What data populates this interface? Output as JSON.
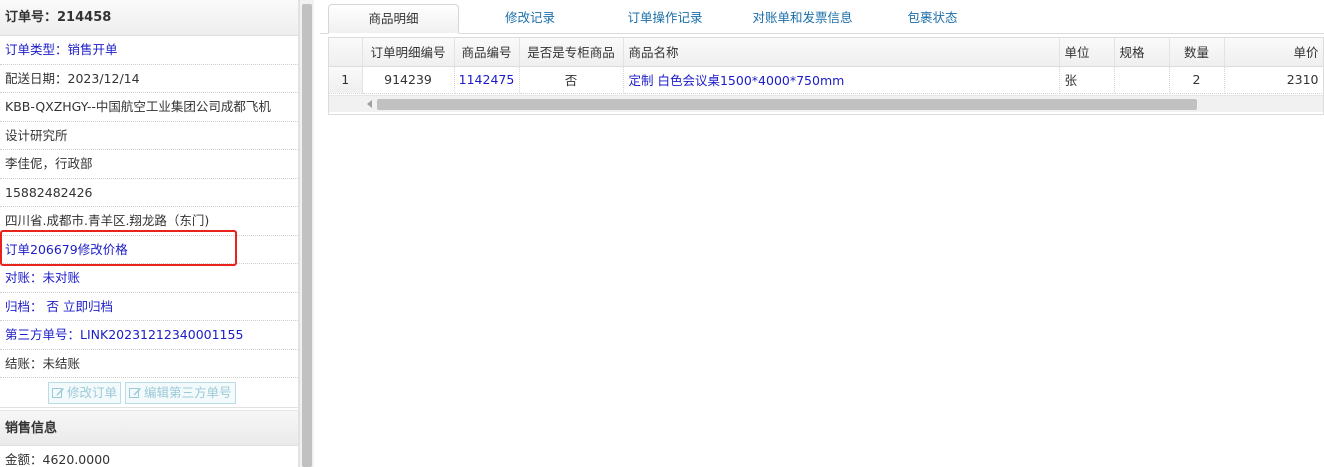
{
  "order": {
    "number_label": "订单号：",
    "number": "214458",
    "rows": [
      {
        "label": "订单类型：",
        "value": "销售开单",
        "style": "blue"
      },
      {
        "label": "配送日期：",
        "value": "2023/12/14",
        "style": "normal"
      },
      {
        "label": "",
        "value": "KBB-QXZHGY--中国航空工业集团公司成都飞机",
        "style": "normal"
      },
      {
        "label": "",
        "value": "设计研究所",
        "style": "normal"
      },
      {
        "label": "",
        "value": "李佳伲，行政部",
        "style": "normal"
      },
      {
        "label": "",
        "value": "15882482426",
        "style": "normal"
      },
      {
        "label": "",
        "value": "四川省.成都市.青羊区.翔龙路（东门)",
        "style": "normal"
      },
      {
        "label": "",
        "value": "订单206679修改价格",
        "style": "blue"
      },
      {
        "label": "对账：",
        "value": "未对账",
        "style": "blue"
      },
      {
        "label": "归档：",
        "value": "否",
        "link": "立即归档",
        "style": "blue"
      },
      {
        "label": "第三方单号：",
        "value": "LINK20231212340001155",
        "style": "blue"
      },
      {
        "label": "结账：",
        "value": "未结账",
        "style": "normal"
      }
    ],
    "buttons": {
      "edit_order": "修改订单",
      "edit_third_party": "编辑第三方单号"
    }
  },
  "sales": {
    "header": "销售信息",
    "amount_label": "金额：",
    "amount": "4620.0000"
  },
  "tabs": [
    {
      "label": "商品明细",
      "active": true
    },
    {
      "label": "修改记录",
      "active": false
    },
    {
      "label": "订单操作记录",
      "active": false
    },
    {
      "label": "对账单和发票信息",
      "active": false
    },
    {
      "label": "包裹状态",
      "active": false
    }
  ],
  "table": {
    "columns": [
      "订单明细编号",
      "商品编号",
      "是否是专柜商品",
      "商品名称",
      "单位",
      "规格",
      "数量",
      "单价"
    ],
    "rows": [
      {
        "rownum": "1",
        "detail_id": "914239",
        "product_id": "1142475",
        "is_counter": "否",
        "name": "定制 白色会议桌1500*4000*750mm",
        "unit": "张",
        "spec": "",
        "quantity": "2",
        "price": "2310"
      }
    ]
  },
  "colors": {
    "link_blue": "#1c1cc8",
    "tab_blue": "#1a6ea8",
    "highlight_red": "#e8231b"
  }
}
